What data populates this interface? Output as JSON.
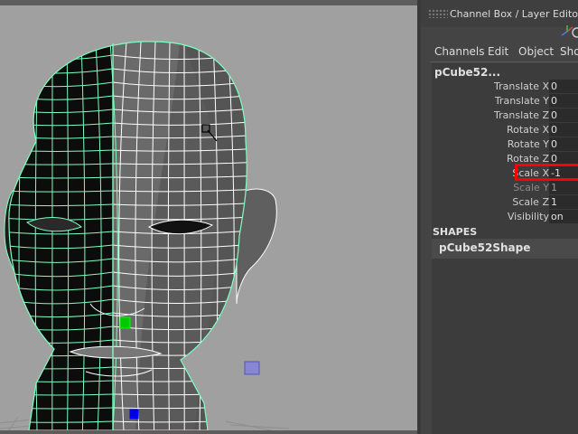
{
  "panel": {
    "title": "Channel Box / Layer Editor",
    "menus": [
      "Channels",
      "Edit",
      "Object",
      "Show"
    ]
  },
  "channel_box": {
    "node_name": "pCube52...",
    "attributes": [
      {
        "label": "Translate X",
        "value": "0"
      },
      {
        "label": "Translate Y",
        "value": "0"
      },
      {
        "label": "Translate Z",
        "value": "0"
      },
      {
        "label": "Rotate X",
        "value": "0"
      },
      {
        "label": "Rotate Y",
        "value": "0"
      },
      {
        "label": "Rotate Z",
        "value": "0"
      },
      {
        "label": "Scale X",
        "value": "-1",
        "highlighted": true
      },
      {
        "label": "Scale Y",
        "value": "1"
      },
      {
        "label": "Scale Z",
        "value": "1"
      },
      {
        "label": "Visibility",
        "value": "on"
      }
    ],
    "shapes_header": "SHAPES",
    "shape_name": "pCube52Shape"
  },
  "colors": {
    "highlight": "#ff0000",
    "wireframe": "#7dffc0",
    "viewport_bg": "#a0a0a0",
    "panel_bg": "#444444"
  },
  "icons": [
    "grip-icon",
    "axis-gizmo-icon",
    "mouse-cursor-icon",
    "selection-handle-icon"
  ]
}
